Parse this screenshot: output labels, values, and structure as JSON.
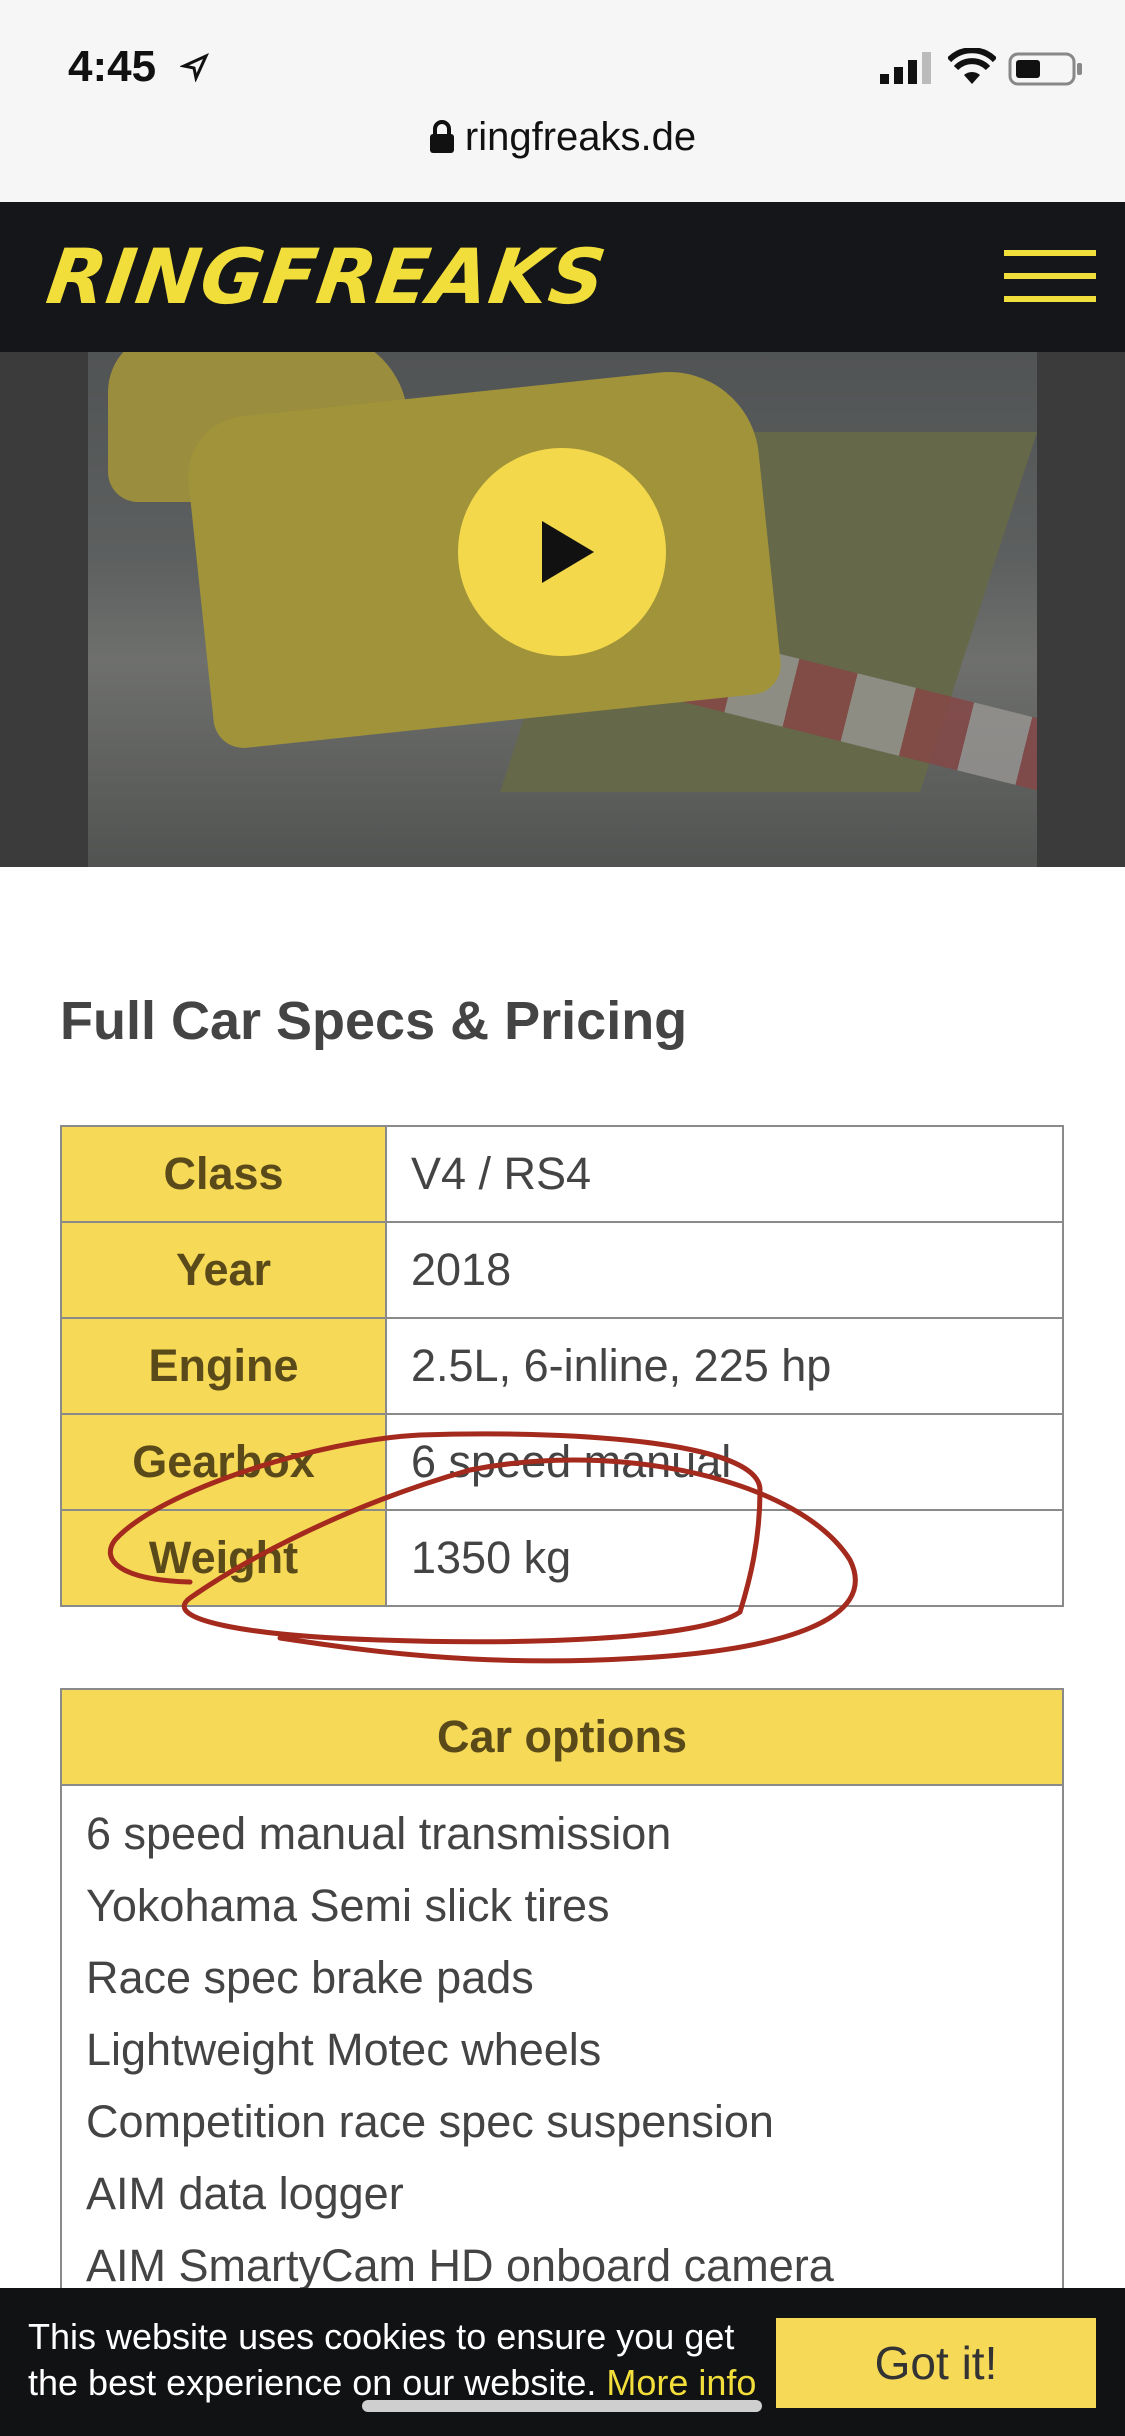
{
  "status_bar": {
    "time": "4:45",
    "url": "ringfreaks.de"
  },
  "header": {
    "logo_text": "RINGFREAKS",
    "menu_icon": "hamburger-icon",
    "brand_color": "#f2de3a"
  },
  "video": {
    "play_icon": "play-icon"
  },
  "specs": {
    "title": "Full Car Specs & Pricing",
    "rows": [
      {
        "key": "Class",
        "value": "V4 / RS4"
      },
      {
        "key": "Year",
        "value": "2018"
      },
      {
        "key": "Engine",
        "value": "2.5L, 6-inline, 225 hp"
      },
      {
        "key": "Gearbox",
        "value": "6 speed manual"
      },
      {
        "key": "Weight",
        "value": "1350 kg"
      }
    ]
  },
  "options": {
    "title": "Car options",
    "items": [
      "6 speed manual transmission",
      "Yokohama Semi slick tires",
      "Race spec brake pads",
      "Lightweight Motec wheels",
      "Competition race spec suspension",
      "AIM data logger",
      "AIM SmartyCam HD onboard camera"
    ]
  },
  "cookie": {
    "message": "This website uses cookies to ensure you get the best experience on our website.",
    "more_info": "More info",
    "button": "Got it!"
  }
}
